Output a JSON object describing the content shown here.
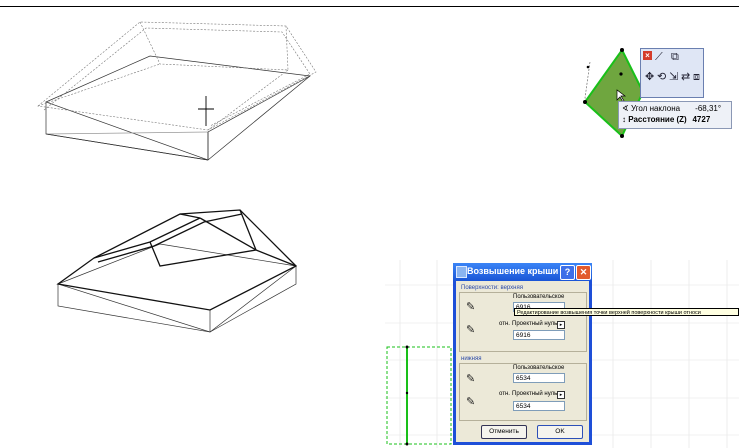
{
  "tracker": {
    "rows": [
      {
        "symbol": "∢",
        "label": "Угол наклона",
        "value": "-68,31°"
      },
      {
        "symbol": "↕",
        "label": "Расстояние (Z)",
        "value": "4727"
      }
    ]
  },
  "dialog": {
    "title": "Возвышение крыши",
    "help": "?",
    "close": "✕",
    "upper": {
      "group_label": "Поверхности: верхняя",
      "custom_label": "Пользовательское",
      "custom_value": "6916",
      "rel_label": "отн.",
      "rel_select": "Проектный нуль",
      "rel_value": "6916"
    },
    "lower": {
      "group_label": "нижняя",
      "custom_label": "Пользовательское",
      "custom_value": "6534",
      "rel_label": "отн.",
      "rel_select": "Проектный нуль",
      "rel_value": "6534"
    },
    "cancel": "Отменить",
    "ok": "OK"
  },
  "tooltip": "Редактирование возвышения точки верхней поверхности крыши относи",
  "colors": {
    "roof_fill": "#6fa63f",
    "roof_edge": "#19c019",
    "dialog_border": "#1e4fd8",
    "selection": "#19c019"
  }
}
